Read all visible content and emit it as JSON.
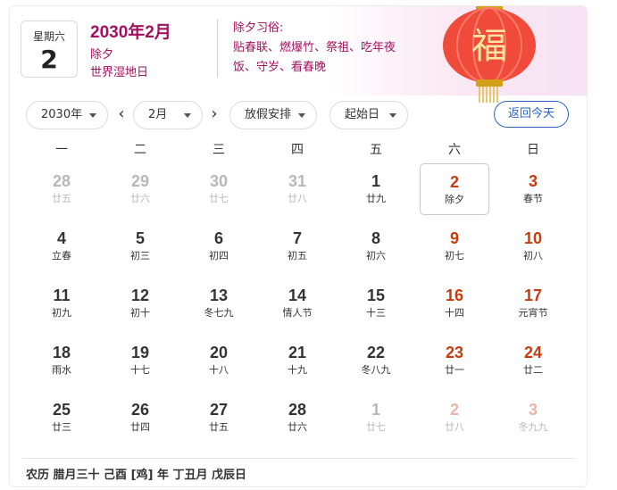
{
  "header": {
    "weekday": "星期六",
    "day": "2",
    "year_month": "2030年2月",
    "lunar_line1": "除夕",
    "lunar_line2": "世界湿地日",
    "customs_title": "除夕习俗:",
    "customs_line1": "贴春联、燃爆竹、祭祖、吃年夜",
    "customs_line2": "饭、守岁、看春晚",
    "lantern_char": "福"
  },
  "toolbar": {
    "year_select": "2030年",
    "month_select": "2月",
    "holiday_select": "放假安排",
    "start_select": "起始日",
    "today_button": "返回今天",
    "prev_symbol": "‹",
    "next_symbol": "›"
  },
  "weekdays": [
    "一",
    "二",
    "三",
    "四",
    "五",
    "六",
    "日"
  ],
  "colors": {
    "accent": "#a3115e",
    "weekend": "#c93a0d",
    "link": "#2a63c9"
  },
  "days": [
    {
      "n": "28",
      "l": "廿五",
      "s": "fade"
    },
    {
      "n": "29",
      "l": "廿六",
      "s": "fade"
    },
    {
      "n": "30",
      "l": "廿七",
      "s": "fade"
    },
    {
      "n": "31",
      "l": "廿八",
      "s": "fade"
    },
    {
      "n": "1",
      "l": "廿九",
      "s": "norm"
    },
    {
      "n": "2",
      "l": "除夕",
      "s": "wkd",
      "sel": true
    },
    {
      "n": "3",
      "l": "春节",
      "s": "wkd"
    },
    {
      "n": "4",
      "l": "立春",
      "s": "norm"
    },
    {
      "n": "5",
      "l": "初三",
      "s": "norm"
    },
    {
      "n": "6",
      "l": "初四",
      "s": "norm"
    },
    {
      "n": "7",
      "l": "初五",
      "s": "norm"
    },
    {
      "n": "8",
      "l": "初六",
      "s": "norm"
    },
    {
      "n": "9",
      "l": "初七",
      "s": "wkd"
    },
    {
      "n": "10",
      "l": "初八",
      "s": "wkd"
    },
    {
      "n": "11",
      "l": "初九",
      "s": "norm"
    },
    {
      "n": "12",
      "l": "初十",
      "s": "norm"
    },
    {
      "n": "13",
      "l": "冬七九",
      "s": "norm"
    },
    {
      "n": "14",
      "l": "情人节",
      "s": "norm"
    },
    {
      "n": "15",
      "l": "十三",
      "s": "norm"
    },
    {
      "n": "16",
      "l": "十四",
      "s": "wkd"
    },
    {
      "n": "17",
      "l": "元宵节",
      "s": "wkd"
    },
    {
      "n": "18",
      "l": "雨水",
      "s": "norm"
    },
    {
      "n": "19",
      "l": "十七",
      "s": "norm"
    },
    {
      "n": "20",
      "l": "十八",
      "s": "norm"
    },
    {
      "n": "21",
      "l": "十九",
      "s": "norm"
    },
    {
      "n": "22",
      "l": "冬八九",
      "s": "norm"
    },
    {
      "n": "23",
      "l": "廿一",
      "s": "wkd"
    },
    {
      "n": "24",
      "l": "廿二",
      "s": "wkd"
    },
    {
      "n": "25",
      "l": "廿三",
      "s": "norm"
    },
    {
      "n": "26",
      "l": "廿四",
      "s": "norm"
    },
    {
      "n": "27",
      "l": "廿五",
      "s": "norm"
    },
    {
      "n": "28",
      "l": "廿六",
      "s": "norm"
    },
    {
      "n": "1",
      "l": "廿七",
      "s": "fade"
    },
    {
      "n": "2",
      "l": "廿八",
      "s": "fadewk"
    },
    {
      "n": "3",
      "l": "冬九九",
      "s": "fadewk"
    }
  ],
  "footer": "农历 腊月三十  己酉 [鸡] 年  丁丑月 戊辰日"
}
